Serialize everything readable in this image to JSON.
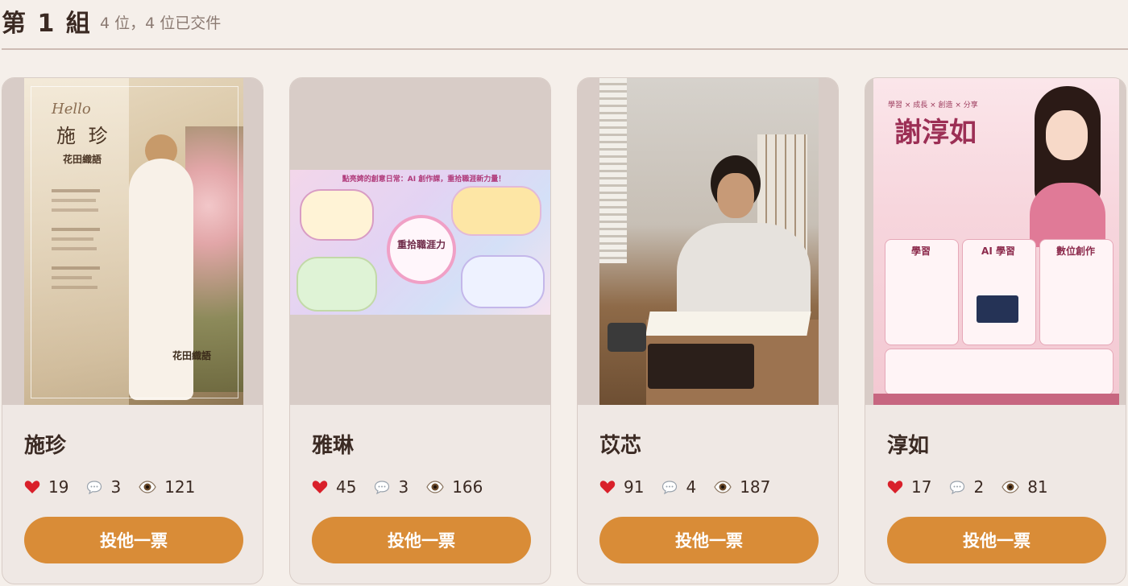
{
  "header": {
    "title": "第 1 組",
    "subtitle": "4 位，4 位已交件"
  },
  "cards": [
    {
      "name": "施珍",
      "likes": "19",
      "comments": "3",
      "views": "121",
      "vote_label": "投他一票",
      "image_text": {
        "hello": "Hello",
        "name": "施 珍",
        "brand": "花田織語",
        "footer": "花田織語"
      }
    },
    {
      "name": "雅琳",
      "likes": "45",
      "comments": "3",
      "views": "166",
      "vote_label": "投他一票",
      "image_text": {
        "banner": "點亮婢的創意日常：AI 創作課，重拾職涯新力量！",
        "center": "重拾職涯力"
      }
    },
    {
      "name": "苡芯",
      "likes": "91",
      "comments": "4",
      "views": "187",
      "vote_label": "投他一票",
      "image_text": {}
    },
    {
      "name": "淳如",
      "likes": "17",
      "comments": "2",
      "views": "81",
      "vote_label": "投他一票",
      "image_text": {
        "tagline": "學習 × 成長 × 創造 × 分享",
        "name": "謝淳如",
        "col1": "學習",
        "col2": "AI 學習",
        "col3": "數位創作"
      }
    }
  ],
  "colors": {
    "background": "#f5efea",
    "card": "#efe8e4",
    "vote_button": "#d98c37",
    "text": "#3b2a23",
    "muted": "#8b7a72"
  },
  "icons": {
    "like": "heart-icon",
    "comment": "speech-bubble-icon",
    "view": "eye-icon"
  }
}
